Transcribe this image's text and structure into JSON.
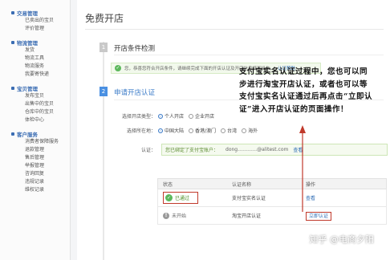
{
  "sidebar": {
    "groups": [
      {
        "title": "交易管理",
        "items": [
          "已卖出的宝贝",
          "评价管理"
        ]
      },
      {
        "title": "物流管理",
        "items": [
          "发货",
          "物流工具",
          "物流服务",
          "我要寄快递"
        ]
      },
      {
        "title": "宝贝管理",
        "items": [
          "发布宝贝",
          "出售中的宝贝",
          "仓库中的宝贝",
          "体检中心"
        ]
      },
      {
        "title": "客户服务",
        "items": [
          "消费者保障服务",
          "退款管理",
          "售后管理",
          "举报管理",
          "咨询回复",
          "违规记录",
          "维权记录"
        ]
      }
    ]
  },
  "main": {
    "page_title": "免费开店",
    "step1": {
      "num": "1",
      "title": "开店条件检测"
    },
    "notice": {
      "text": "您，恭喜您符合开店条件，请继续完成下面的开店认证及开店信息填写操作。",
      "link": "认证帮助"
    },
    "step2": {
      "num": "2",
      "title": "申请开店认证"
    },
    "store_type": {
      "label": "选择开店类型：",
      "options": [
        "个人开店",
        "企业开店"
      ]
    },
    "location": {
      "label": "选择所在地：",
      "options": [
        "中国大陆",
        "香港/澳门",
        "台湾",
        "海外"
      ]
    },
    "auth": {
      "label": "认证：",
      "text": "您已绑定了支付宝账户：",
      "account": "dong…………@alitest.com",
      "link": "查看"
    },
    "table": {
      "headers": [
        "状态",
        "认证名称",
        "操作"
      ],
      "rows": [
        {
          "status": "已通过",
          "name": "支付宝实名认证",
          "op": "查看"
        },
        {
          "status": "未开始",
          "name": "淘宝开店认证",
          "op": "立即认证"
        }
      ]
    }
  },
  "annotation": "支付宝实名认证过程中，您也可以同步进行淘宝开店认证，或者也可以等支付宝实名认证通过后再点击“立即认证”进入开店认证的页面操作！",
  "watermark": "知乎 @电商夕阳"
}
